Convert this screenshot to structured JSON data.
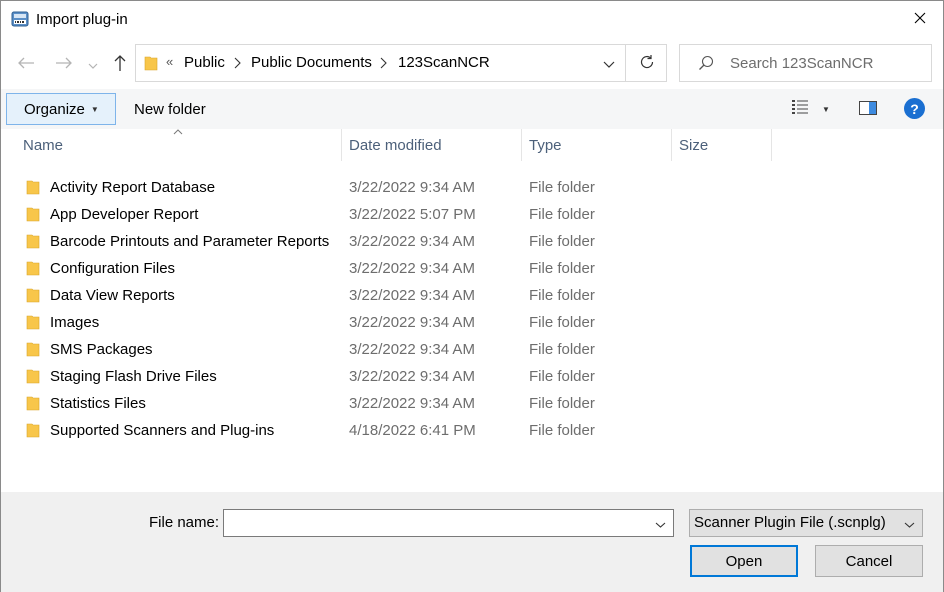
{
  "window": {
    "title": "Import plug-in"
  },
  "address": {
    "overflow": "«",
    "crumbs": [
      "Public",
      "Public Documents",
      "123ScanNCR"
    ]
  },
  "search": {
    "placeholder": "Search 123ScanNCR"
  },
  "toolbar": {
    "organize_label": "Organize",
    "new_folder_label": "New folder",
    "help_label": "?"
  },
  "columns": {
    "name": "Name",
    "date": "Date modified",
    "type": "Type",
    "size": "Size"
  },
  "files": [
    {
      "name": "Activity Report Database",
      "date": "3/22/2022 9:34 AM",
      "type": "File folder"
    },
    {
      "name": "App Developer Report",
      "date": "3/22/2022 5:07 PM",
      "type": "File folder"
    },
    {
      "name": "Barcode Printouts and Parameter Reports",
      "date": "3/22/2022 9:34 AM",
      "type": "File folder"
    },
    {
      "name": "Configuration Files",
      "date": "3/22/2022 9:34 AM",
      "type": "File folder"
    },
    {
      "name": "Data View Reports",
      "date": "3/22/2022 9:34 AM",
      "type": "File folder"
    },
    {
      "name": "Images",
      "date": "3/22/2022 9:34 AM",
      "type": "File folder"
    },
    {
      "name": "SMS Packages",
      "date": "3/22/2022 9:34 AM",
      "type": "File folder"
    },
    {
      "name": "Staging Flash Drive Files",
      "date": "3/22/2022 9:34 AM",
      "type": "File folder"
    },
    {
      "name": "Statistics Files",
      "date": "3/22/2022 9:34 AM",
      "type": "File folder"
    },
    {
      "name": "Supported Scanners and Plug-ins",
      "date": "4/18/2022 6:41 PM",
      "type": "File folder"
    }
  ],
  "bottom": {
    "file_name_label": "File name:",
    "file_name_value": "",
    "filter_value": "Scanner Plugin File (.scnplg)",
    "open_label": "Open",
    "cancel_label": "Cancel"
  },
  "colors": {
    "accent": "#0078d7",
    "folder": "#f8c64a",
    "column_header_text": "#4c607a",
    "secondary_text": "#6d6d6d"
  }
}
